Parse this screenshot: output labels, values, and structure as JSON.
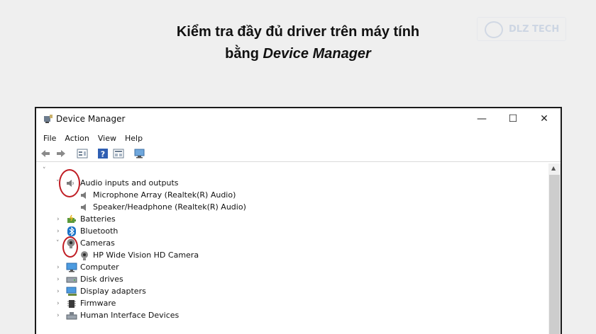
{
  "headline": {
    "line1": "Kiểm tra đầy đủ driver trên máy tính",
    "line2_prefix": "bằng ",
    "line2_italic": "Device Manager"
  },
  "logo": {
    "text": "DLZ TECH"
  },
  "window": {
    "title": "Device Manager",
    "controls": {
      "minimize": "—",
      "maximize": "☐",
      "close": "✕"
    },
    "menu": [
      "File",
      "Action",
      "View",
      "Help"
    ]
  },
  "tree": {
    "root_chevron": "˅",
    "items": [
      {
        "label": "Audio inputs and outputs",
        "icon": "speaker-icon",
        "expanded": true
      },
      {
        "label": "Microphone Array (Realtek(R) Audio)",
        "icon": "speaker-icon",
        "child": true
      },
      {
        "label": "Speaker/Headphone (Realtek(R) Audio)",
        "icon": "speaker-icon",
        "child": true
      },
      {
        "label": "Batteries",
        "icon": "battery-icon"
      },
      {
        "label": "Bluetooth",
        "icon": "bluetooth-icon"
      },
      {
        "label": "Cameras",
        "icon": "camera-icon",
        "expanded": true
      },
      {
        "label": "HP Wide Vision HD Camera",
        "icon": "camera-icon",
        "child": true
      },
      {
        "label": "Computer",
        "icon": "monitor-icon"
      },
      {
        "label": "Disk drives",
        "icon": "disk-icon"
      },
      {
        "label": "Display adapters",
        "icon": "display-adapter-icon"
      },
      {
        "label": "Firmware",
        "icon": "firmware-icon"
      },
      {
        "label": "Human Interface Devices",
        "icon": "hid-icon"
      }
    ]
  },
  "colors": {
    "highlight": "#c01d24",
    "accent": "#1a73c9"
  }
}
